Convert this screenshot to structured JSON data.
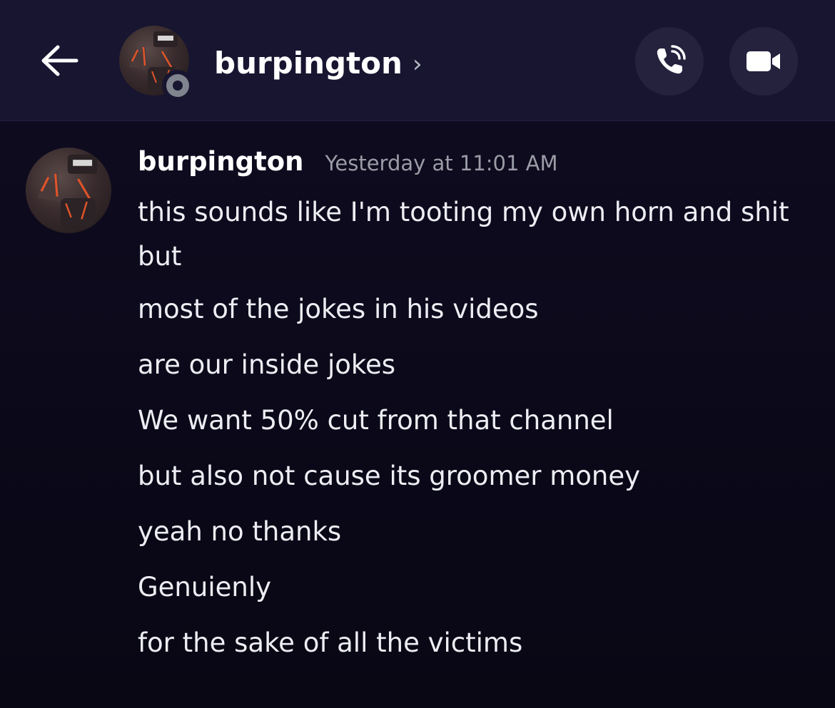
{
  "header": {
    "username": "burpington",
    "chevron": "›",
    "back_icon": "arrow-left-icon",
    "call_icon": "phone-icon",
    "video_icon": "video-camera-icon",
    "status": "offline"
  },
  "message": {
    "author": "burpington",
    "timestamp": "Yesterday at 11:01 AM",
    "lines": [
      "this sounds like I'm tooting my own horn and shit but",
      "most of the jokes in his videos",
      "are our inside jokes",
      "We want 50% cut from that channel",
      "but also not cause its groomer money",
      "yeah no thanks",
      "Genuienly",
      "for the sake of all the victims"
    ]
  },
  "colors": {
    "header_bg": "#171530",
    "body_bg": "#0c0a1a",
    "button_bg": "#24223d",
    "timestamp": "#9a9ca6",
    "status_offline": "#80848e",
    "avatar_accent": "#e0542a"
  }
}
